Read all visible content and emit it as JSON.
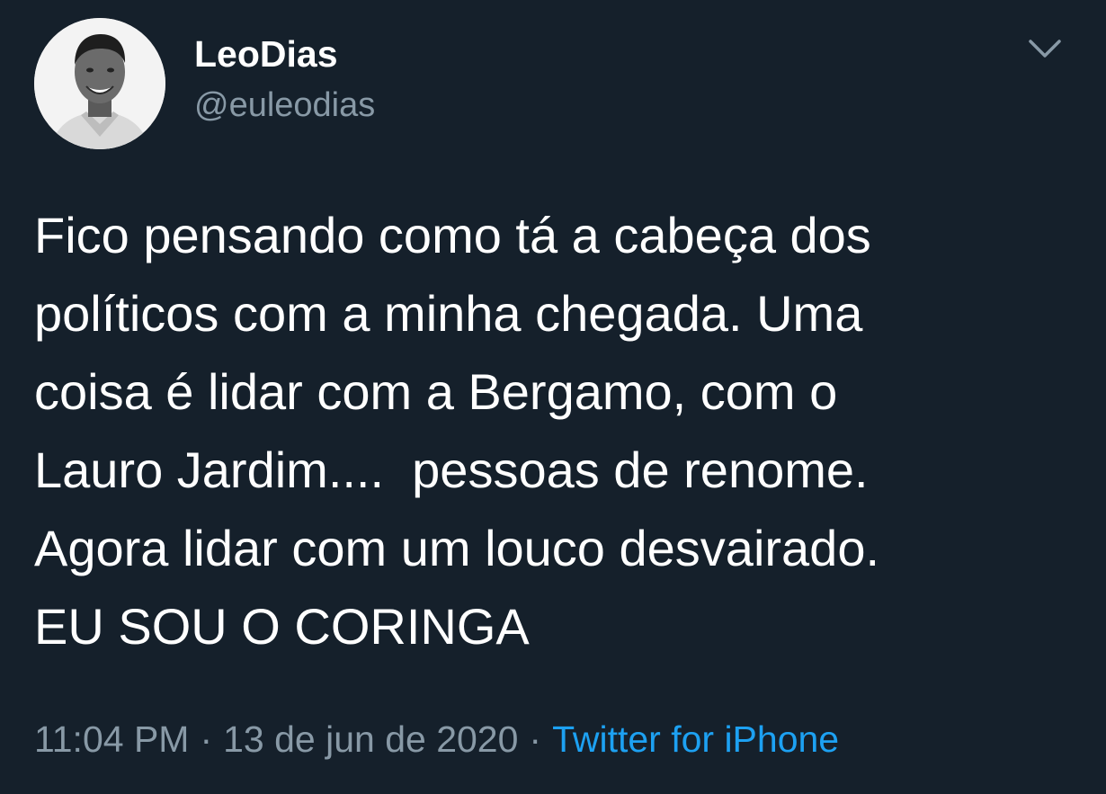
{
  "user": {
    "display_name": "LeoDias",
    "handle": "@euleodias",
    "avatar_icon": "profile-photo"
  },
  "menu": {
    "icon": "chevron-down-icon"
  },
  "tweet": {
    "lines": [
      "Fico pensando como tá a cabeça dos",
      "políticos com a minha chegada. Uma",
      "coisa é lidar com a Bergamo, com o",
      "Lauro Jardim....  pessoas de renome.",
      "Agora lidar com um louco desvairado.",
      "EU SOU O CORINGA"
    ]
  },
  "meta": {
    "time": "11:04 PM",
    "separator": "·",
    "date": "13 de jun de 2020",
    "source": "Twitter for iPhone"
  },
  "colors": {
    "background": "#15202b",
    "text": "#ffffff",
    "secondary": "#8899a6",
    "link": "#1da1f2"
  }
}
